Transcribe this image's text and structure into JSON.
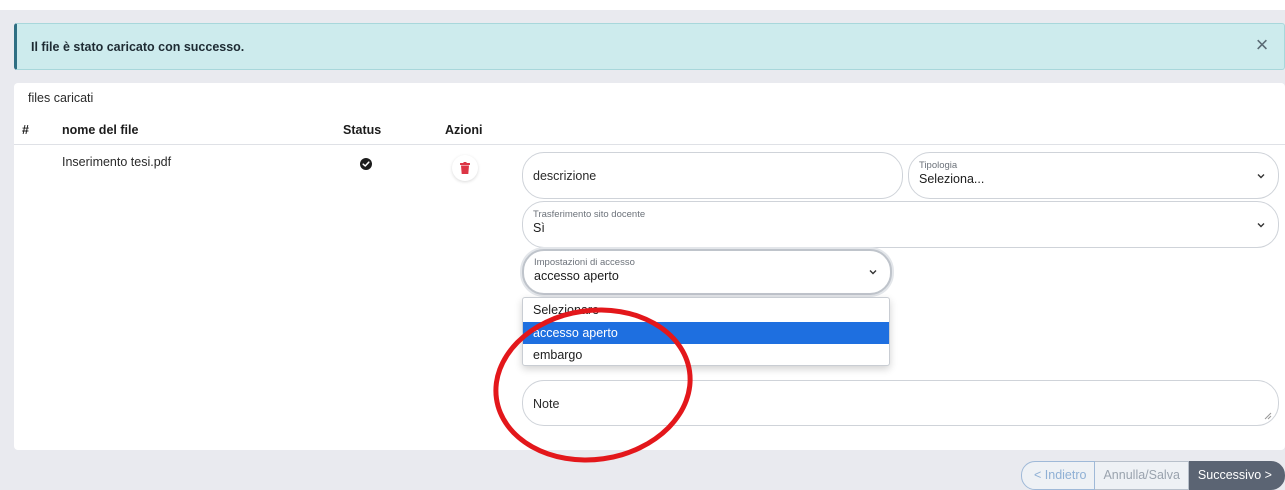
{
  "alert": {
    "message": "Il file è stato caricato con successo.",
    "close_icon": "×"
  },
  "card": {
    "title": "files caricati",
    "columns": [
      "#",
      "nome del file",
      "Status",
      "Azioni"
    ],
    "row": {
      "filename": "Inserimento tesi.pdf",
      "status": "check-circle-icon",
      "action": "trash-icon"
    }
  },
  "form": {
    "descrizione": {
      "placeholder": "descrizione"
    },
    "tipologia": {
      "label": "Tipologia",
      "value": "Seleziona..."
    },
    "trasferimento": {
      "label": "Trasferimento sito docente",
      "value": "Sì"
    },
    "impostazioni": {
      "label": "Impostazioni di accesso",
      "value": "accesso aperto"
    },
    "dropdown_options": [
      "Selezionare",
      "accesso aperto",
      "embargo"
    ],
    "note": {
      "placeholder": "Note"
    }
  },
  "buttons": {
    "back": "< Indietro",
    "cancel": "Annulla/Salva",
    "next": "Successivo >"
  },
  "colors": {
    "alert_bg": "#cdebed",
    "selected_option": "#1e6fe0",
    "trash": "#dc3545",
    "annotation": "#e3171b"
  }
}
